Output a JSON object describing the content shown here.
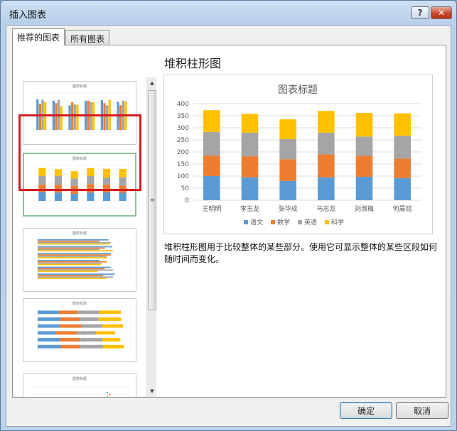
{
  "window": {
    "title": "插入图表",
    "help_label": "?",
    "close_label": "✕"
  },
  "tabs": [
    {
      "label": "推荐的图表",
      "active": true
    },
    {
      "label": "所有图表",
      "active": false
    }
  ],
  "thumbnails": [
    {
      "title": "图表标题",
      "kind": "clustered-column"
    },
    {
      "title": "图表标题",
      "kind": "stacked-column"
    },
    {
      "title": "图表标题",
      "kind": "clustered-bar"
    },
    {
      "title": "图表标题",
      "kind": "stacked-bar"
    },
    {
      "title": "图表标题",
      "kind": "scatter"
    }
  ],
  "main": {
    "chart_type_name": "堆积柱形图",
    "description": "堆积柱形图用于比较整体的某些部分。使用它可显示整体的某些区段如何随时间而变化。"
  },
  "buttons": {
    "ok": "确定",
    "cancel": "取消"
  },
  "colors": {
    "语文": "#5b9bd5",
    "数学": "#ed7d31",
    "英语": "#a5a5a5",
    "科学": "#ffc000"
  },
  "chart_data": {
    "type": "bar",
    "stacked": true,
    "title": "图表标题",
    "categories": [
      "王明明",
      "李玉龙",
      "张华成",
      "马志龙",
      "刘淑梅",
      "何晨铭"
    ],
    "series": [
      {
        "name": "语文",
        "values": [
          100,
          95,
          80,
          95,
          97,
          92
        ]
      },
      {
        "name": "数学",
        "values": [
          85,
          87,
          90,
          95,
          87,
          80
        ]
      },
      {
        "name": "英语",
        "values": [
          98,
          98,
          83,
          90,
          80,
          95
        ]
      },
      {
        "name": "科学",
        "values": [
          90,
          78,
          82,
          90,
          98,
          93
        ]
      }
    ],
    "ylim": [
      0,
      400
    ],
    "yticks": [
      "0",
      "50",
      "100",
      "150",
      "200",
      "250",
      "300",
      "350",
      "400"
    ],
    "grid": true,
    "legend": "bottom"
  }
}
